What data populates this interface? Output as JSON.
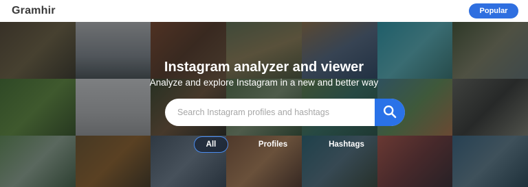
{
  "header": {
    "brand": "Gramhir",
    "popular_label": "Popular"
  },
  "hero": {
    "title": "Instagram analyzer and viewer",
    "subtitle": "Analyze and explore Instagram in a new and better way"
  },
  "search": {
    "placeholder": "Search Instagram profiles and hashtags",
    "value": "",
    "icon": "search-icon"
  },
  "filters": [
    {
      "label": "All",
      "active": true
    },
    {
      "label": "Profiles",
      "active": false
    },
    {
      "label": "Hashtags",
      "active": false
    }
  ],
  "colors": {
    "accent": "#2f6fe0",
    "search_button": "#2a72e8",
    "active_tab_border": "#4a8cf0"
  }
}
